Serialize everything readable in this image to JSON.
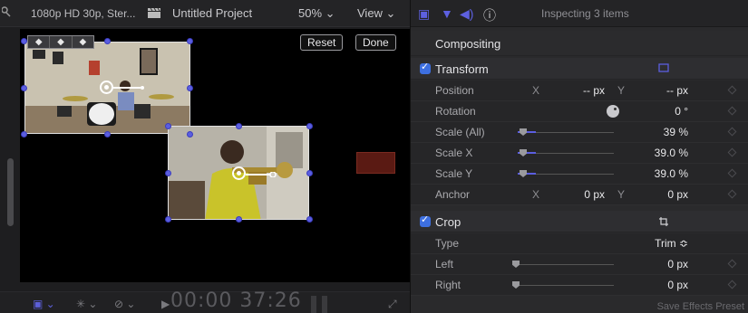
{
  "viewer": {
    "format": "1080p HD 30p, Ster...",
    "project_title": "Untitled Project",
    "zoom": "50% ⌄",
    "view_menu": "View ⌄",
    "reset_label": "Reset",
    "done_label": "Done",
    "timecode": "00:00 37:26",
    "keyframe_prev": "◆",
    "keyframe_add": "◆",
    "keyframe_next": "◆"
  },
  "inspector": {
    "status": "Inspecting 3 items",
    "compositing_label": "Compositing",
    "transform": {
      "label": "Transform",
      "position": {
        "label": "Position",
        "x_axis": "X",
        "x_value": "-- px",
        "y_axis": "Y",
        "y_value": "-- px"
      },
      "rotation": {
        "label": "Rotation",
        "value": "0 °"
      },
      "scale_all": {
        "label": "Scale (All)",
        "value": "39 %"
      },
      "scale_x": {
        "label": "Scale X",
        "value": "39.0 %"
      },
      "scale_y": {
        "label": "Scale Y",
        "value": "39.0 %"
      },
      "anchor": {
        "label": "Anchor",
        "x_axis": "X",
        "x_value": "0 px",
        "y_axis": "Y",
        "y_value": "0 px"
      }
    },
    "crop": {
      "label": "Crop",
      "type": {
        "label": "Type",
        "value": "Trim ≎"
      },
      "left": {
        "label": "Left",
        "value": "0 px"
      },
      "right": {
        "label": "Right",
        "value": "0 px"
      }
    },
    "footer_button": "Save Effects Preset"
  },
  "colors": {
    "accent": "#5b5ee0",
    "checkbox": "#3d6fe0",
    "swatch": "#5a1a13"
  }
}
